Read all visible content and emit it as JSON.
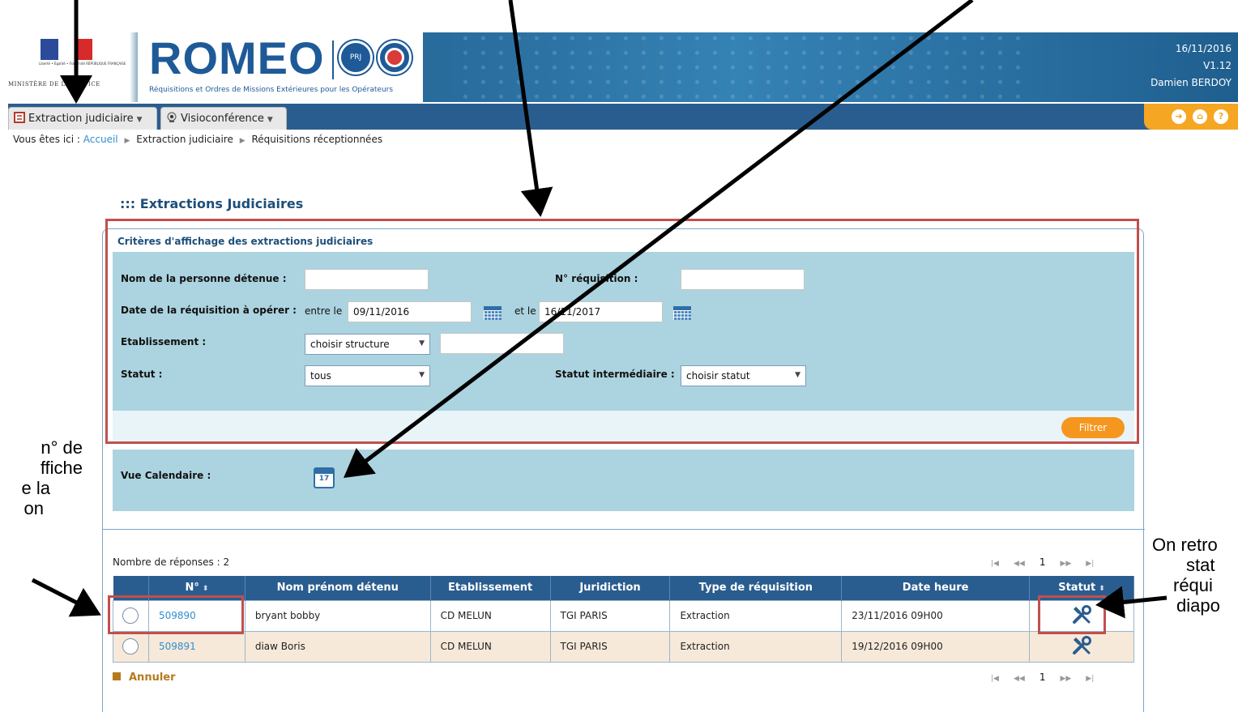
{
  "header": {
    "brand_title": "ROMEO",
    "subtitle": "Réquisitions et Ordres de Missions Extérieures pour les Opérateurs",
    "ministry_label": "MINISTÈRE DE LA JUSTICE",
    "motto": "Liberté • Égalité • Fraternité RÉPUBLIQUE FRANÇAISE",
    "badge_prj": "PRJ",
    "date": "16/11/2016",
    "version": "V1.12",
    "user": "Damien BERDOY"
  },
  "menu": {
    "extraction": "Extraction judiciaire",
    "visio": "Visioconférence"
  },
  "breadcrumb": {
    "prefix": "Vous êtes ici :",
    "home": "Accueil",
    "level2": "Extraction judiciaire",
    "level3": "Réquisitions réceptionnées"
  },
  "page_title": "::: Extractions Judiciaires",
  "criteria": {
    "title": "Critères d'affichage des extractions judiciaires",
    "nom_label": "Nom de la personne détenue :",
    "num_label": "N° réquisition :",
    "date_label": "Date de la réquisition à opérer :",
    "between": "entre le",
    "date_from": "09/11/2016",
    "and": "et le",
    "date_to": "16/11/2017",
    "etab_label": "Etablissement :",
    "etab_value": "choisir structure",
    "statut_label": "Statut :",
    "statut_value": "tous",
    "statut_inter_label": "Statut intermédiaire :",
    "statut_inter_value": "choisir statut",
    "filter_button": "Filtrer"
  },
  "calendar": {
    "label": "Vue Calendaire :",
    "icon_day": "17"
  },
  "results": {
    "count": "Nombre de réponses : 2",
    "page": "1",
    "columns": [
      "N°",
      "Nom prénom détenu",
      "Etablissement",
      "Juridiction",
      "Type de réquisition",
      "Date heure",
      "Statut"
    ],
    "rows": [
      {
        "num": "509890",
        "name": "bryant bobby",
        "etab": "CD MELUN",
        "jur": "TGI PARIS",
        "type": "Extraction",
        "date": "23/11/2016 09H00"
      },
      {
        "num": "509891",
        "name": "diaw Boris",
        "etab": "CD MELUN",
        "jur": "TGI PARIS",
        "type": "Extraction",
        "date": "19/12/2016 09H00"
      }
    ],
    "cancel": "Annuler"
  },
  "annotations": {
    "left_lines": [
      "n° de",
      "ffiche",
      "e la",
      "on"
    ],
    "right_lines": [
      "On retro",
      "stat",
      "réqui",
      "diapo"
    ]
  },
  "colors": {
    "accent_blue": "#2a5d8f",
    "panel": "#acd4e0",
    "orange": "#f5961e",
    "highlight": "#c0504d"
  }
}
